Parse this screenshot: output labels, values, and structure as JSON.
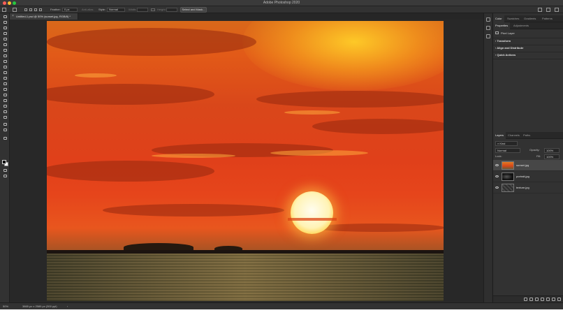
{
  "window": {
    "title": "Adobe Photoshop 2020",
    "traffic_lights": [
      "#ff5f57",
      "#febc2e",
      "#28c840"
    ]
  },
  "options_bar": {
    "feather_label": "Feather:",
    "feather_value": "0 px",
    "anti_alias_label": "Anti-alias",
    "style_label": "Style:",
    "style_value": "Normal",
    "width_label": "Width:",
    "height_label": "Height:",
    "select_mask_label": "Select and Mask..."
  },
  "document_tab": {
    "label": "Untitled-1.psd @ 50% (sunset.jpg, RGB/8) *",
    "close_glyph": "×"
  },
  "status_bar": {
    "zoom": "50%",
    "doc_info": "3865 px x 2589 px (300 ppi)",
    "arrow": "›"
  },
  "panels": {
    "top_tabs": [
      "Color",
      "Swatches",
      "Gradients",
      "Patterns"
    ],
    "props_tabs": [
      "Properties",
      "Adjustments"
    ],
    "pixel_layer_label": "Pixel Layer",
    "sections": [
      "Transform",
      "Align and Distribute",
      "Quick Actions"
    ],
    "layer_tabs": [
      "Layers",
      "Channels",
      "Paths"
    ],
    "kind_label": "Kind",
    "blend_mode": "Normal",
    "opacity_label": "Opacity:",
    "opacity_value": "100%",
    "lock_label": "Lock:",
    "fill_label": "Fill:",
    "fill_value": "100%"
  },
  "layers": [
    {
      "name": "sunset.jpg",
      "selected": true,
      "thumb": "#c8401a"
    },
    {
      "name": "portrait.jpg",
      "selected": false,
      "thumb": "#1a1a1a"
    },
    {
      "name": "texture.jpg",
      "selected": false,
      "thumb": "#3a3a3a"
    }
  ],
  "canvas_image": "sunset over the sea"
}
